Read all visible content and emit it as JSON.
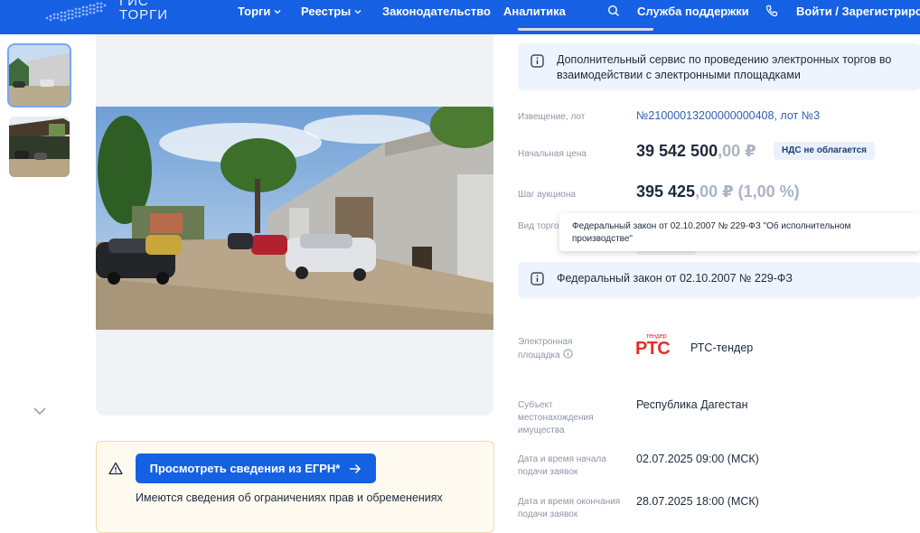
{
  "header": {
    "logo_text_line1": "ГИС",
    "logo_text_line2": "ТОРГИ",
    "nav": [
      {
        "label": "Торги"
      },
      {
        "label": "Реестры"
      },
      {
        "label": "Законодательство"
      },
      {
        "label": "Аналитика"
      }
    ],
    "support_label": "Служба поддержки",
    "login_label": "Войти / Зарегистриро"
  },
  "icons": {
    "search": "search-icon",
    "phone": "phone-icon",
    "info": "info-icon",
    "warning": "warning-icon",
    "arrow_right": "arrow-right-icon",
    "chevron_down": "chevron-down-icon"
  },
  "colors": {
    "brand": "#1660e4",
    "info_bg": "#eef4fd",
    "warning_bg": "#fffaf0",
    "rts_red": "#e42d24"
  },
  "notice": {
    "info_text": "Дополнительный сервис по проведению электронных торгов во взаимодействии с электронными площадками"
  },
  "lot": {
    "notice_label": "Извещение, лот",
    "notice_value": "№21000013200000000408, лот №3",
    "start_price_label": "Начальная цена",
    "start_price_main": "39 542 500",
    "start_price_frac": ",00 ₽",
    "vat_badge": "НДС не облагается",
    "step_label": "Шаг аукциона",
    "step_main": "395 425",
    "step_frac": ",00 ₽ (1,00 %)",
    "auction_type_label": "Вид торгов",
    "tooltip": "Федеральный закон от 02.10.2007 № 229-ФЗ \"Об исполнительном производстве\"",
    "law_text": "Федеральный закон от 02.10.2007 № 229-ФЗ",
    "platform_label": "Электронная площадка",
    "platform_logo_small": "тендер",
    "platform_logo_big": "РТС",
    "platform_name": "РТС-тендер",
    "subject_label": "Субъект местонахождения имущества",
    "subject_value": "Республика Дагестан",
    "start_date_label": "Дата и время начала подачи заявок",
    "start_date_value": "02.07.2025 09:00 (МСК)",
    "end_date_label": "Дата и время окончания подачи заявок",
    "end_date_value": "28.07.2025 18:00 (МСК)"
  },
  "egrn": {
    "button_label": "Просмотреть сведения из ЕГРН*",
    "note": "Имеются сведения об ограничениях прав и обременениях"
  },
  "gallery": {
    "thumb_count": 2,
    "selected_index": 0
  }
}
